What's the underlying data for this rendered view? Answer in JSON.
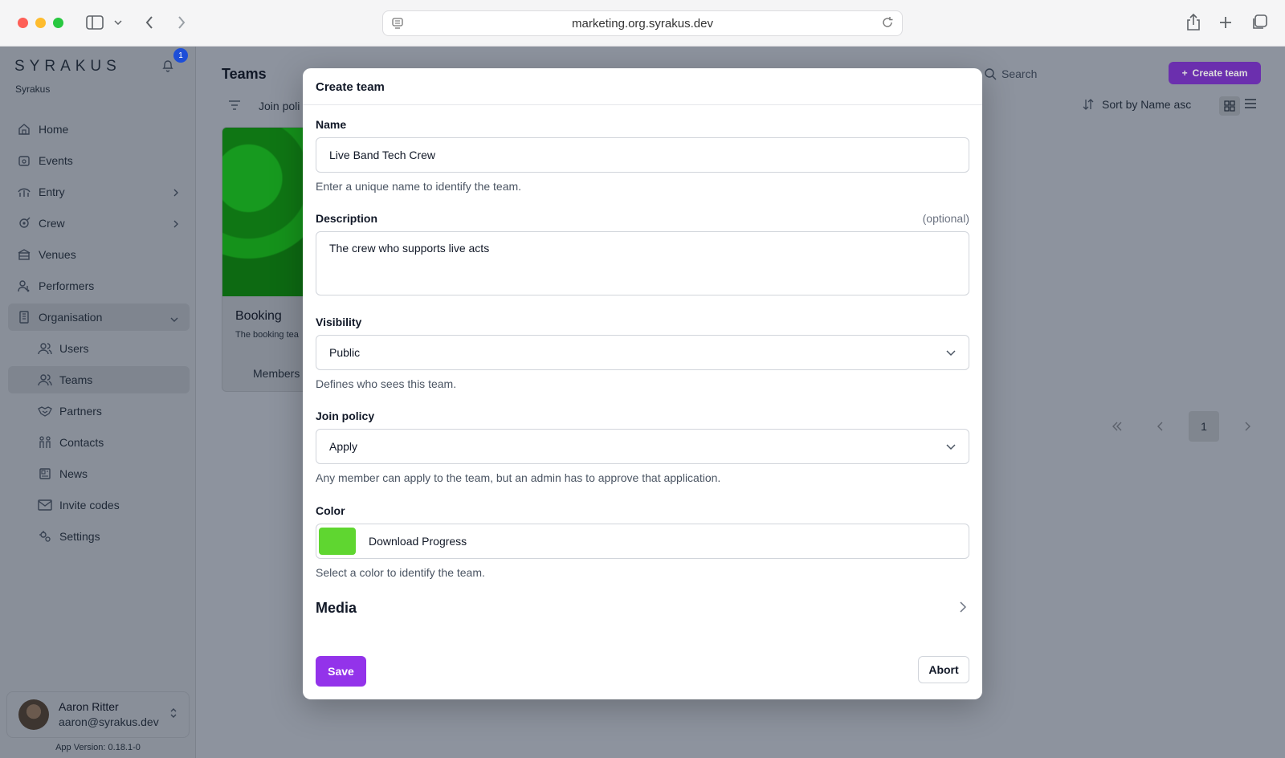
{
  "browser": {
    "url": "marketing.org.syrakus.dev"
  },
  "sidebar": {
    "logo": "SYRAKUS",
    "org_name": "Syrakus",
    "notification_count": "1",
    "items": [
      {
        "label": "Home",
        "icon": "home-icon"
      },
      {
        "label": "Events",
        "icon": "calendar-icon"
      },
      {
        "label": "Entry",
        "icon": "entry-icon"
      },
      {
        "label": "Crew",
        "icon": "crew-icon"
      },
      {
        "label": "Venues",
        "icon": "venue-icon"
      },
      {
        "label": "Performers",
        "icon": "performer-icon"
      },
      {
        "label": "Organisation",
        "icon": "building-icon"
      }
    ],
    "sub_items": [
      {
        "label": "Users",
        "icon": "users-icon"
      },
      {
        "label": "Teams",
        "icon": "team-icon"
      },
      {
        "label": "Partners",
        "icon": "handshake-icon"
      },
      {
        "label": "Contacts",
        "icon": "contacts-icon"
      },
      {
        "label": "News",
        "icon": "newspaper-icon"
      },
      {
        "label": "Invite codes",
        "icon": "mail-icon"
      },
      {
        "label": "Settings",
        "icon": "gear-icon"
      }
    ],
    "user": {
      "name": "Aaron Ritter",
      "email": "aaron@syrakus.dev"
    },
    "app_version": "App Version: 0.18.1-0"
  },
  "main": {
    "title": "Teams",
    "filter_label": "Join poli",
    "search_placeholder": "Search",
    "create_button": "Create team",
    "sort_label": "Sort by Name asc",
    "team_card": {
      "name": "Booking",
      "description": "The booking tea",
      "members_label": "Members"
    },
    "pagination": {
      "current_page": "1"
    }
  },
  "modal": {
    "title": "Create team",
    "name_label": "Name",
    "name_value": "Live Band Tech Crew",
    "name_help": "Enter a unique name to identify the team.",
    "description_label": "Description",
    "optional_label": "(optional)",
    "description_value": "The crew who supports live acts",
    "visibility_label": "Visibility",
    "visibility_value": "Public",
    "visibility_help": "Defines who sees this team.",
    "join_policy_label": "Join policy",
    "join_policy_value": "Apply",
    "join_policy_help": "Any member can apply to the team, but an admin has to approve that application.",
    "color_label": "Color",
    "color_value": "Download Progress",
    "color_hex": "#5fd630",
    "color_help": "Select a color to identify the team.",
    "media_label": "Media",
    "save_button": "Save",
    "abort_button": "Abort"
  },
  "colors": {
    "accent": "#9333ea",
    "overlay": "#8d939e"
  }
}
